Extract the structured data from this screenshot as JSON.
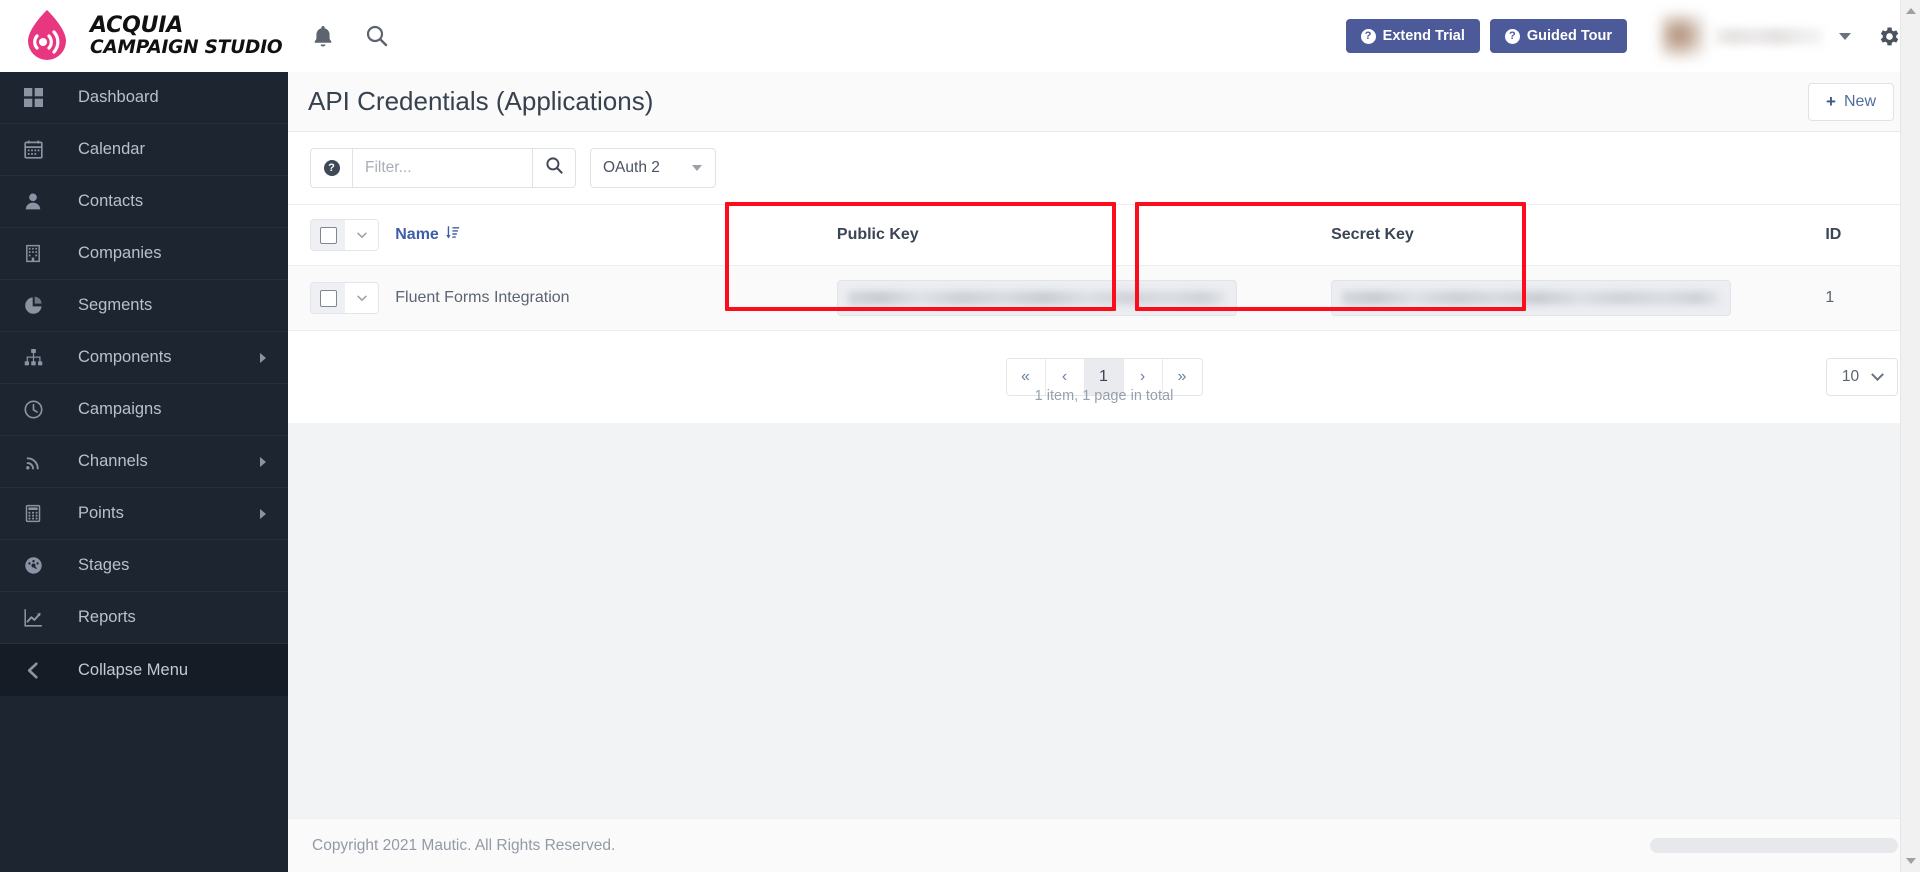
{
  "brand": {
    "line1": "ACQUIA",
    "line2": "CAMPAIGN STUDIO",
    "logo_color": "#e8367f",
    "icon": "acquia-droplet-signal-logo"
  },
  "topbar": {
    "notifications_icon": "bell-icon",
    "search_icon": "search-icon",
    "extend_trial_label": "Extend Trial",
    "guided_tour_label": "Guided Tour",
    "button_color": "#4d5a9a",
    "user_menu_caret": "chevron-down-icon",
    "settings_icon": "gear-icon"
  },
  "sidebar": {
    "background": "#1d2531",
    "items": [
      {
        "label": "Dashboard",
        "icon": "grid-icon",
        "has_submenu": false
      },
      {
        "label": "Calendar",
        "icon": "calendar-icon",
        "has_submenu": false
      },
      {
        "label": "Contacts",
        "icon": "user-icon",
        "has_submenu": false
      },
      {
        "label": "Companies",
        "icon": "building-icon",
        "has_submenu": false
      },
      {
        "label": "Segments",
        "icon": "pie-chart-icon",
        "has_submenu": false
      },
      {
        "label": "Components",
        "icon": "sitemap-icon",
        "has_submenu": true
      },
      {
        "label": "Campaigns",
        "icon": "clock-icon",
        "has_submenu": false
      },
      {
        "label": "Channels",
        "icon": "rss-icon",
        "has_submenu": true
      },
      {
        "label": "Points",
        "icon": "calculator-icon",
        "has_submenu": true
      },
      {
        "label": "Stages",
        "icon": "gauge-icon",
        "has_submenu": false
      },
      {
        "label": "Reports",
        "icon": "line-chart-icon",
        "has_submenu": false
      }
    ],
    "collapse": {
      "label": "Collapse Menu",
      "icon": "chevron-left-icon"
    }
  },
  "page": {
    "title": "API Credentials (Applications)",
    "new_button_label": "New",
    "new_button_icon": "plus-icon"
  },
  "toolbar": {
    "help_icon": "question-circle-icon",
    "filter_placeholder": "Filter...",
    "filter_value": "",
    "search_icon": "search-icon",
    "auth_select_value": "OAuth 2"
  },
  "table": {
    "columns": [
      {
        "key": "select",
        "label": ""
      },
      {
        "key": "name",
        "label": "Name",
        "sort_icon": "sort-amount-desc-icon",
        "sorted": true
      },
      {
        "key": "public_key",
        "label": "Public Key",
        "highlighted": true
      },
      {
        "key": "secret_key",
        "label": "Secret Key",
        "highlighted": true
      },
      {
        "key": "id",
        "label": "ID"
      }
    ],
    "rows": [
      {
        "name": "Fluent Forms Integration",
        "public_key": "",
        "secret_key": "",
        "id": "1",
        "public_key_redacted": true,
        "secret_key_redacted": true
      }
    ],
    "select_all_caret": "chevron-down-icon"
  },
  "highlight": {
    "color": "#fc0d1b",
    "targets": [
      "public-key-column",
      "secret-key-column"
    ]
  },
  "pagination": {
    "first_label": "«",
    "prev_label": "‹",
    "pages": [
      "1"
    ],
    "active_page": "1",
    "next_label": "›",
    "last_label": "»",
    "summary": "1 item, 1 page in total",
    "per_page_value": "10"
  },
  "footer": {
    "copyright": "Copyright 2021 Mautic. All Rights Reserved."
  }
}
